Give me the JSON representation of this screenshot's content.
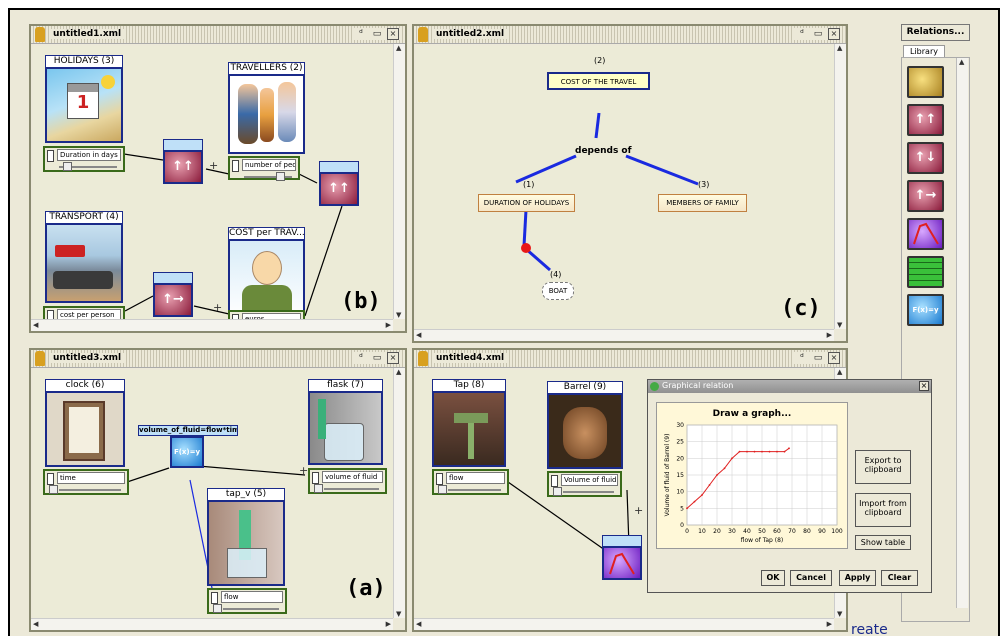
{
  "panes": {
    "p1": {
      "title": "untitled1.xml"
    },
    "p2": {
      "title": "untitled2.xml"
    },
    "p3": {
      "title": "untitled3.xml"
    },
    "p4": {
      "title": "untitled4.xml"
    }
  },
  "window_buttons": {
    "restore": "ᵈ",
    "maximize": "▭",
    "close": "☒"
  },
  "p1": {
    "holidays": {
      "label": "HOLIDAYS (3)",
      "slider": "Duration in days"
    },
    "travellers": {
      "label": "TRAVELLERS (2)",
      "slider": "number of people"
    },
    "transport": {
      "label": "TRANSPORT (4)",
      "slider": "cost per person"
    },
    "cost": {
      "label": "COST per TRAV...",
      "slider": "euros"
    },
    "plus1": "+",
    "plus2": "+",
    "panel_label": "(b)"
  },
  "p2": {
    "cost_travel": {
      "num": "(2)",
      "label": "COST OF THE TRAVEL"
    },
    "depends": "depends of",
    "duration": {
      "num": "(1)",
      "label": "DURATION OF HOLIDAYS"
    },
    "members": {
      "num": "(3)",
      "label": "MEMBERS OF FAMILY"
    },
    "boat": {
      "num": "(4)",
      "label": "BOAT"
    },
    "panel_label": "(c)"
  },
  "p3": {
    "clock": {
      "label": "clock (6)",
      "slider": "time"
    },
    "flask": {
      "label": "flask (7)",
      "slider": "volume of fluid"
    },
    "tap_v": {
      "label": "tap_v (5)",
      "slider": "flow"
    },
    "formula": "volume_of_fluid=flow*time",
    "fx": "F(x)=y",
    "plus": "+",
    "panel_label": "(a)"
  },
  "p4": {
    "tap": {
      "label": "Tap (8)",
      "slider": "flow"
    },
    "barrel": {
      "label": "Barrel (9)",
      "slider": "Volume of fluid"
    },
    "plus": "+"
  },
  "library": {
    "relations_button": "Relations...",
    "tab": "Library"
  },
  "dialog": {
    "title": "Graphical relation",
    "close": "×",
    "graph_title": "Draw a graph...",
    "ylabel": "Volume of fluid of Barrel (9)",
    "xlabel": "flow of Tap (8)",
    "export": "Export to clipboard",
    "import": "Import from clipboard",
    "show_table": "Show table",
    "ok": "OK",
    "cancel": "Cancel",
    "apply": "Apply",
    "clear": "Clear"
  },
  "chart_data": {
    "type": "line",
    "title": "Draw a graph...",
    "xlabel": "flow of Tap (8)",
    "ylabel": "Volume of fluid of Barrel (9)",
    "xlim": [
      0,
      100
    ],
    "ylim": [
      0,
      30
    ],
    "xticks": [
      0,
      10,
      20,
      30,
      40,
      50,
      60,
      70,
      80,
      90,
      100
    ],
    "yticks": [
      0,
      5,
      10,
      15,
      20,
      25,
      30
    ],
    "grid": true,
    "color": "#e02020",
    "x": [
      0,
      5,
      10,
      15,
      20,
      25,
      30,
      35,
      40,
      45,
      50,
      55,
      60,
      65,
      68
    ],
    "y": [
      5,
      7,
      9,
      12,
      15,
      17,
      20,
      22,
      22,
      22,
      22,
      22,
      22,
      22,
      23
    ]
  },
  "bottom_fragment": "reate"
}
